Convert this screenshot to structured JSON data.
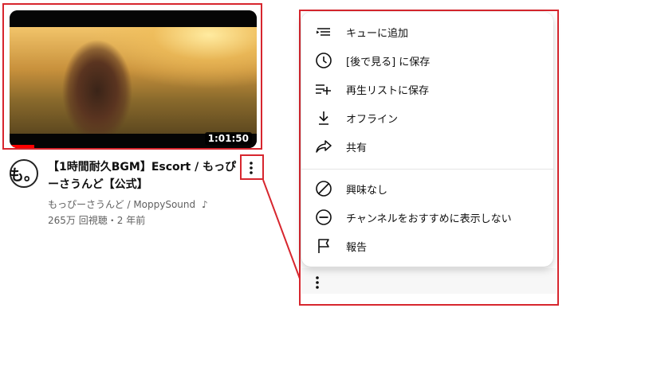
{
  "video": {
    "duration": "1:01:50",
    "watched_fraction": 0.1,
    "title": "【1時間耐久BGM】Escort / もっぴーさうんど【公式】",
    "channel": "もっぴーさうんど / MoppySound",
    "channel_badge": "♪",
    "views": "265万 回視聴",
    "separator": "・",
    "age": "2 年前",
    "avatar_text": "も。"
  },
  "menu": {
    "items": [
      {
        "label": "キューに追加",
        "icon": "add-to-queue-icon"
      },
      {
        "label": "[後で見る] に保存",
        "icon": "clock-icon"
      },
      {
        "label": "再生リストに保存",
        "icon": "playlist-add-icon"
      },
      {
        "label": "オフライン",
        "icon": "download-icon"
      },
      {
        "label": "共有",
        "icon": "share-icon"
      },
      {
        "label": "興味なし",
        "icon": "not-interested-icon"
      },
      {
        "label": "チャンネルをおすすめに表示しない",
        "icon": "block-channel-icon"
      },
      {
        "label": "報告",
        "icon": "flag-icon"
      }
    ]
  },
  "colors": {
    "annotation": "#d7262e",
    "progress": "#ff0000",
    "secondary_text": "#606060"
  }
}
